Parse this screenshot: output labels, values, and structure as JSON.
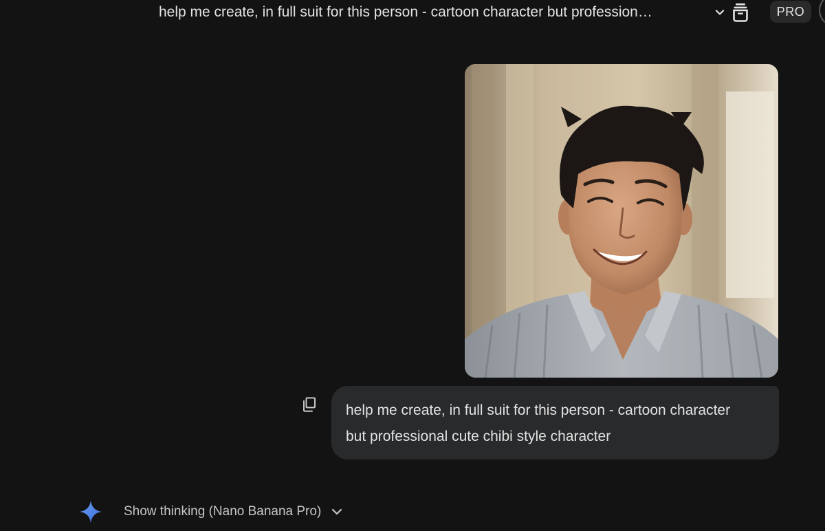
{
  "header": {
    "title": "help me create, in full suit for this person - cartoon character but profession…",
    "badge": "PRO",
    "icons": {
      "expand": "chevron-down-icon",
      "archive": "archive-icon"
    }
  },
  "conversation": {
    "user_image": {
      "icon": "uploaded-photo"
    },
    "user_message": {
      "line1": "help me create, in full suit for this person - cartoon character",
      "line2": "but professional cute chibi style character",
      "copy_icon": "copy-icon"
    },
    "response": {
      "thinking_label": "Show thinking (Nano Banana Pro)",
      "spark_icon": "gemini-spark-icon",
      "chevron_icon": "chevron-down-icon"
    }
  },
  "colors": {
    "background": "#131313",
    "bubble": "#282a2c",
    "text": "#e3e3e3",
    "badge_bg": "#2a2a2a",
    "spark": "#4a7fe8"
  }
}
